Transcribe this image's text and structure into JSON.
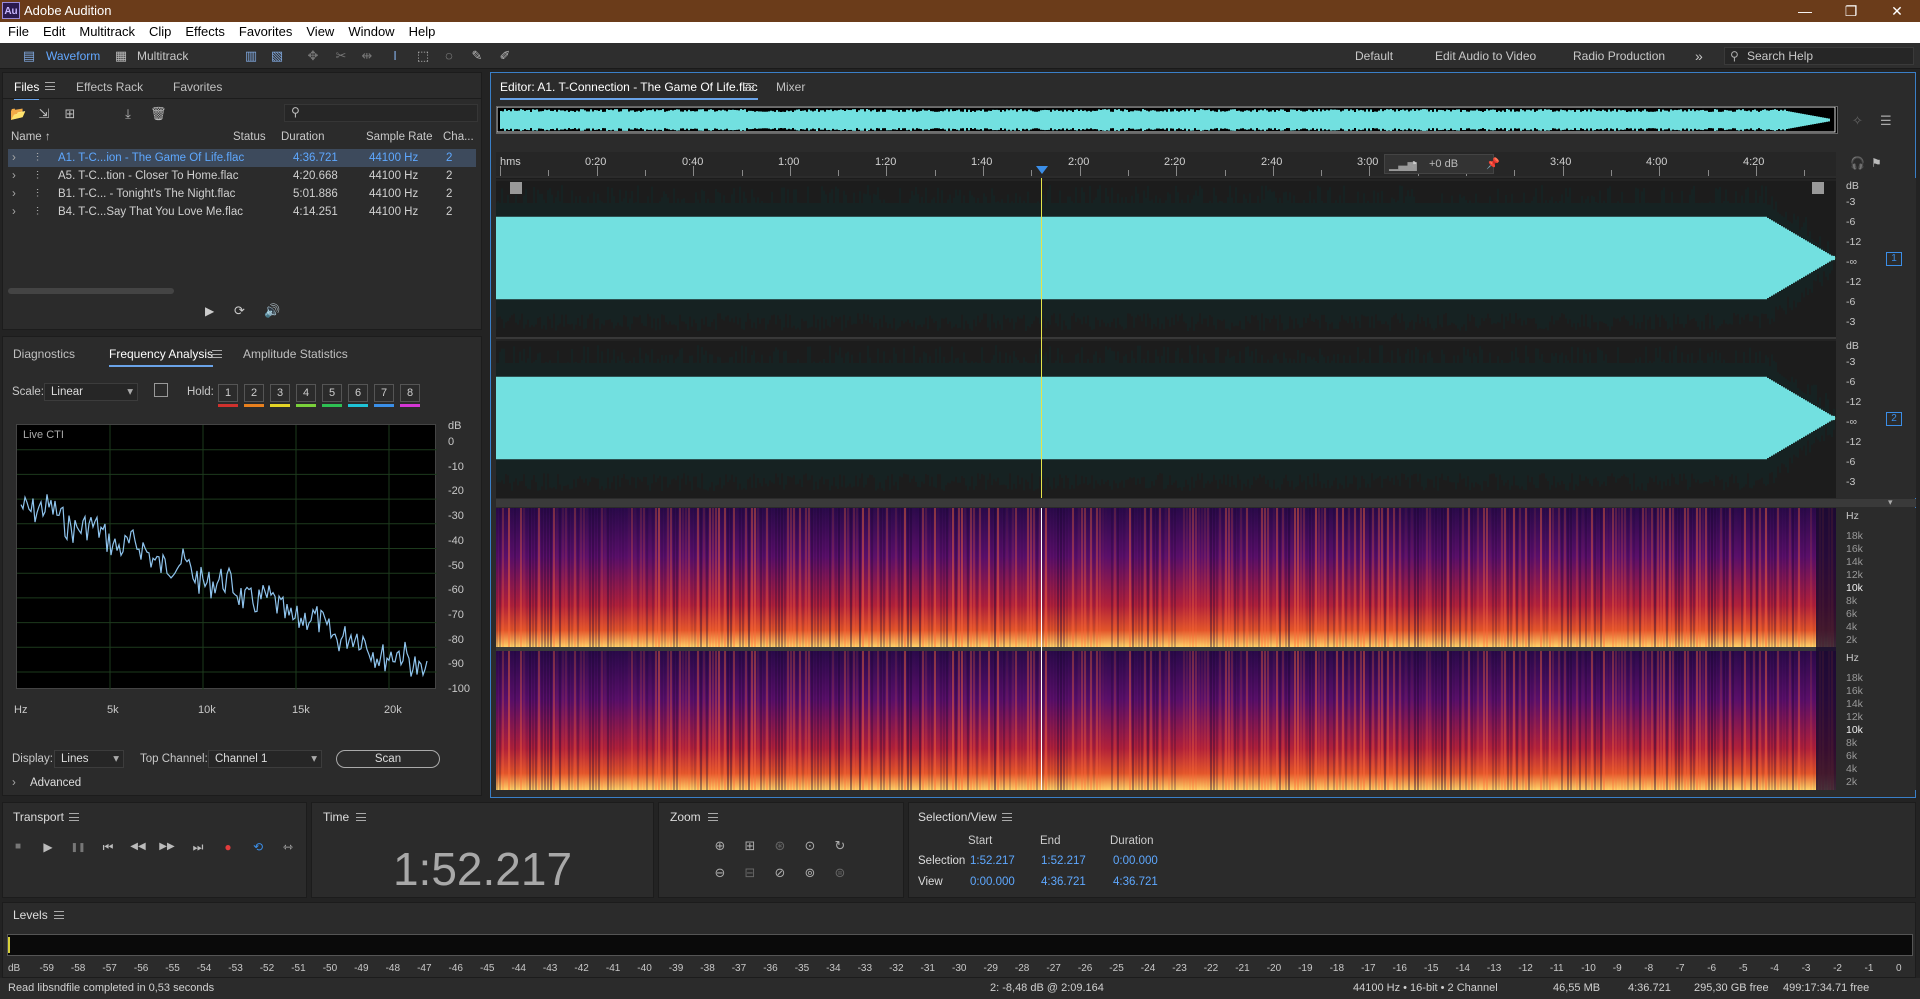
{
  "window": {
    "app_icon": "Au",
    "title": "Adobe Audition",
    "controls": {
      "minimize": "—",
      "maximize": "❐",
      "close": "✕"
    }
  },
  "menu": [
    "File",
    "Edit",
    "Multitrack",
    "Clip",
    "Effects",
    "Favorites",
    "View",
    "Window",
    "Help"
  ],
  "toolbar": {
    "waveform_label": "Waveform",
    "multitrack_label": "Multitrack",
    "workspaces": [
      "Default",
      "Edit Audio to Video",
      "Radio Production"
    ],
    "more": "»",
    "search_placeholder": "Search Help"
  },
  "files_panel": {
    "tabs": [
      "Files",
      "Effects Rack",
      "Favorites"
    ],
    "columns": [
      "Name",
      "Status",
      "Duration",
      "Sample Rate",
      "Cha..."
    ],
    "files": [
      {
        "name": "A1. T-C...ion - The Game Of Life.flac",
        "duration": "4:36.721",
        "sample_rate": "44100 Hz",
        "channels": "2",
        "selected": true
      },
      {
        "name": "A5. T-C...tion - Closer To Home.flac",
        "duration": "4:20.668",
        "sample_rate": "44100 Hz",
        "channels": "2",
        "selected": false
      },
      {
        "name": "B1. T-C... - Tonight's The Night.flac",
        "duration": "5:01.886",
        "sample_rate": "44100 Hz",
        "channels": "2",
        "selected": false
      },
      {
        "name": "B4. T-C...Say That You Love Me.flac",
        "duration": "4:14.251",
        "sample_rate": "44100 Hz",
        "channels": "2",
        "selected": false
      }
    ]
  },
  "analysis_panel": {
    "tabs": [
      "Diagnostics",
      "Frequency Analysis",
      "Amplitude Statistics"
    ],
    "scale_label": "Scale:",
    "scale_value": "Linear",
    "hold_label": "Hold:",
    "hold_buttons": [
      "1",
      "2",
      "3",
      "4",
      "5",
      "6",
      "7",
      "8"
    ],
    "hold_colors": [
      "#d0312d",
      "#e8801e",
      "#e3d325",
      "#7ad13a",
      "#2ec053",
      "#1ec3d6",
      "#3a8fe8",
      "#d336d3"
    ],
    "graph_label": "Live CTI",
    "y_unit": "dB",
    "y_ticks": [
      "0",
      "-10",
      "-20",
      "-30",
      "-40",
      "-50",
      "-60",
      "-70",
      "-80",
      "-90",
      "-100"
    ],
    "x_ticks": [
      "Hz",
      "5k",
      "10k",
      "15k",
      "20k"
    ],
    "display_label": "Display:",
    "display_value": "Lines",
    "top_channel_label": "Top Channel:",
    "top_channel_value": "Channel 1",
    "scan_label": "Scan",
    "advanced_label": "Advanced"
  },
  "editor": {
    "tab_label": "Editor: A1. T-Connection - The Game Of Life.flac",
    "mixer_label": "Mixer",
    "ruler_unit": "hms",
    "ruler_ticks": [
      "0:20",
      "0:40",
      "1:00",
      "1:20",
      "1:40",
      "2:00",
      "2:20",
      "2:40",
      "3:00",
      "3:40",
      "4:00",
      "4:20"
    ],
    "hud_gain": "+0 dB",
    "db_unit": "dB",
    "db_ticks": [
      "-3",
      "-6",
      "-12",
      "-∞",
      "-12",
      "-6",
      "-3"
    ],
    "channel_badges": [
      "1",
      "2"
    ],
    "hz_unit": "Hz",
    "hz_ticks": [
      "18k",
      "16k",
      "14k",
      "12k",
      "10k",
      "8k",
      "6k",
      "4k",
      "2k"
    ],
    "waveform_color": "#72e0e0",
    "playhead_color": "#e6e24a"
  },
  "transport": {
    "title": "Transport",
    "buttons": [
      "■",
      "▶",
      "❚❚",
      "⏮",
      "◀◀",
      "▶▶",
      "⏭",
      "●",
      "⟲",
      "⇿"
    ]
  },
  "time_panel": {
    "title": "Time",
    "value": "1:52.217"
  },
  "zoom_panel": {
    "title": "Zoom"
  },
  "selection_view": {
    "title": "Selection/View",
    "headers": [
      "Start",
      "End",
      "Duration"
    ],
    "selection_label": "Selection",
    "selection": [
      "1:52.217",
      "1:52.217",
      "0:00.000"
    ],
    "view_label": "View",
    "view": [
      "0:00.000",
      "4:36.721",
      "4:36.721"
    ]
  },
  "levels": {
    "title": "Levels",
    "scale": [
      "dB",
      "-59",
      "-58",
      "-57",
      "-56",
      "-55",
      "-54",
      "-53",
      "-52",
      "-51",
      "-50",
      "-49",
      "-48",
      "-47",
      "-46",
      "-45",
      "-44",
      "-43",
      "-42",
      "-41",
      "-40",
      "-39",
      "-38",
      "-37",
      "-36",
      "-35",
      "-34",
      "-33",
      "-32",
      "-31",
      "-30",
      "-29",
      "-28",
      "-27",
      "-26",
      "-25",
      "-24",
      "-23",
      "-22",
      "-21",
      "-20",
      "-19",
      "-18",
      "-17",
      "-16",
      "-15",
      "-14",
      "-13",
      "-12",
      "-11",
      "-10",
      "-9",
      "-8",
      "-7",
      "-6",
      "-5",
      "-4",
      "-3",
      "-2",
      "-1",
      "0"
    ]
  },
  "status": {
    "message": "Read libsndfile completed in 0,53 seconds",
    "cursor": "2: -8,48 dB @ 2:09.164",
    "format": "44100 Hz • 16-bit • 2 Channel",
    "size": "46,55 MB",
    "duration": "4:36.721",
    "free": "295,30 GB free",
    "free_time": "499:17:34.71 free"
  }
}
